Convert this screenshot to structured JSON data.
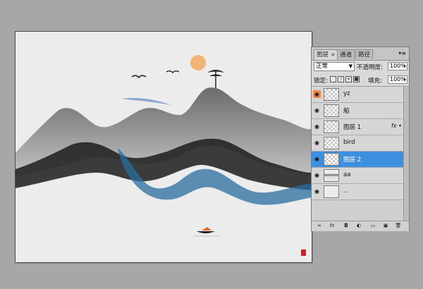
{
  "layers_panel": {
    "tabs": [
      {
        "label": "图层",
        "close": "×"
      },
      {
        "label": "通道"
      },
      {
        "label": "路径"
      }
    ],
    "menu_icon": "panel-menu-icon",
    "menu_symbol": "▾≡",
    "blend_mode": "正常",
    "opacity_label": "不透明度:",
    "opacity_value": "100%",
    "lock_label": "锁定:",
    "fill_label": "填充:",
    "fill_value": "100%",
    "layers": [
      {
        "name": "yz",
        "eye_highlight": true
      },
      {
        "name": "船"
      },
      {
        "name": "图层 1",
        "fx": "fx"
      },
      {
        "name": "bird"
      },
      {
        "name": "图层 2",
        "selected": true
      },
      {
        "name": "aa"
      },
      {
        "name": ".."
      }
    ],
    "bottom_buttons": [
      "link-icon",
      "fx-icon",
      "mask-icon",
      "adjustment-icon",
      "group-folder-icon",
      "new-layer-icon",
      "trash-icon"
    ],
    "bottom_symbols": [
      "∞",
      "fx",
      "◘",
      "◐",
      "▭",
      "▣",
      "🗑"
    ]
  },
  "colors": {
    "workspace": "#a7a7a7",
    "canvas": "#ececec",
    "selection": "#3d8fe0",
    "eye_highlight": "#f0894a",
    "sun": "#f2b476",
    "seal": "#d42020"
  }
}
